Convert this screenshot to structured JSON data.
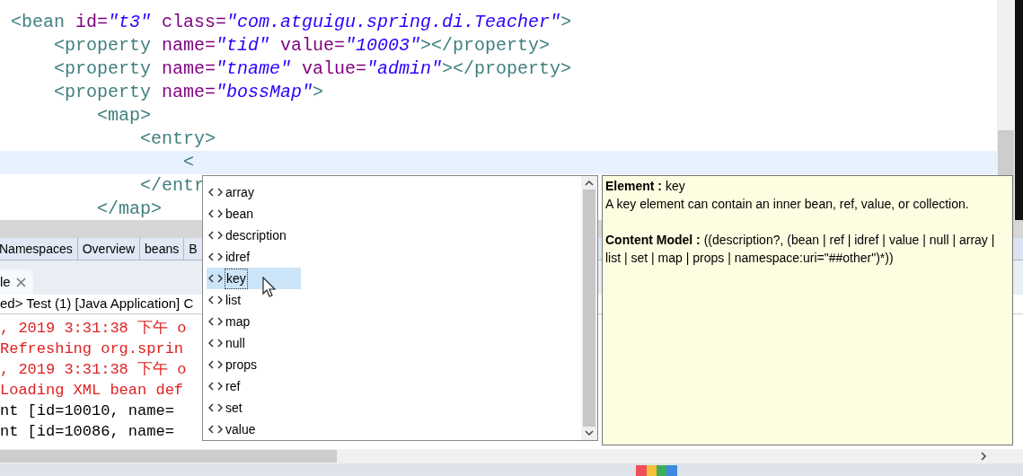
{
  "editor": {
    "lines": [
      {
        "current": false,
        "tokens": [
          {
            "kind": "tag",
            "text": " <bean "
          },
          {
            "kind": "attr",
            "text": "id="
          },
          {
            "kind": "value",
            "text": "\"t3\""
          },
          {
            "kind": "attr",
            "text": " class="
          },
          {
            "kind": "value",
            "text": "\"com.atguigu.spring.di.Teacher\""
          },
          {
            "kind": "tag",
            "text": ">"
          }
        ]
      },
      {
        "current": false,
        "tokens": [
          {
            "kind": "tag",
            "text": "     <property "
          },
          {
            "kind": "attr",
            "text": "name="
          },
          {
            "kind": "value",
            "text": "\"tid\""
          },
          {
            "kind": "attr",
            "text": " value="
          },
          {
            "kind": "value",
            "text": "\"10003\""
          },
          {
            "kind": "tag",
            "text": "></property>"
          }
        ]
      },
      {
        "current": false,
        "tokens": [
          {
            "kind": "tag",
            "text": "     <property "
          },
          {
            "kind": "attr",
            "text": "name="
          },
          {
            "kind": "value",
            "text": "\"tname\""
          },
          {
            "kind": "attr",
            "text": " value="
          },
          {
            "kind": "value",
            "text": "\"admin\""
          },
          {
            "kind": "tag",
            "text": "></property>"
          }
        ]
      },
      {
        "current": false,
        "tokens": [
          {
            "kind": "tag",
            "text": "     <property "
          },
          {
            "kind": "attr",
            "text": "name="
          },
          {
            "kind": "value",
            "text": "\"bossMap\""
          },
          {
            "kind": "tag",
            "text": ">"
          }
        ]
      },
      {
        "current": false,
        "tokens": [
          {
            "kind": "tag",
            "text": "         <map>"
          }
        ]
      },
      {
        "current": false,
        "tokens": [
          {
            "kind": "tag",
            "text": "             <entry>"
          }
        ]
      },
      {
        "current": true,
        "tokens": [
          {
            "kind": "tag",
            "text": "                 <"
          }
        ]
      },
      {
        "current": false,
        "tokens": [
          {
            "kind": "tag",
            "text": "             </entr"
          }
        ]
      },
      {
        "current": false,
        "tokens": [
          {
            "kind": "tag",
            "text": "         </map>"
          }
        ]
      }
    ]
  },
  "editor_tabs": [
    {
      "label": "Namespaces",
      "selected": false
    },
    {
      "label": "Overview",
      "selected": false
    },
    {
      "label": "beans",
      "selected": false
    },
    {
      "label": "B",
      "selected": false
    }
  ],
  "console": {
    "tab": "le",
    "header": "ed> Test (1) [Java Application] C",
    "lines": [
      {
        "kind": "error",
        "text": ", 2019 3:31:38 下午 o"
      },
      {
        "kind": "error",
        "text": "Refreshing org.sprin"
      },
      {
        "kind": "error",
        "text": ", 2019 3:31:38 下午 o"
      },
      {
        "kind": "error",
        "text": "Loading XML bean def"
      },
      {
        "kind": "output",
        "text": "nt [id=10010, name="
      },
      {
        "kind": "output",
        "text": "nt [id=10086, name="
      }
    ]
  },
  "completion": {
    "items": [
      {
        "label": "array",
        "selected": false
      },
      {
        "label": "bean",
        "selected": false
      },
      {
        "label": "description",
        "selected": false
      },
      {
        "label": "idref",
        "selected": false
      },
      {
        "label": "key",
        "selected": true
      },
      {
        "label": "list",
        "selected": false
      },
      {
        "label": "map",
        "selected": false
      },
      {
        "label": "null",
        "selected": false
      },
      {
        "label": "props",
        "selected": false
      },
      {
        "label": "ref",
        "selected": false
      },
      {
        "label": "set",
        "selected": false
      },
      {
        "label": "value",
        "selected": false
      }
    ]
  },
  "info": {
    "title": "**Element :** key",
    "description": "A key element can contain an inner bean, ref, value, or collection.",
    "content_model": "**Content Model :** ((description?, (bean | ref | idref | value | null | array | list | set | map | props | namespace:uri=\"##other\")*))"
  }
}
